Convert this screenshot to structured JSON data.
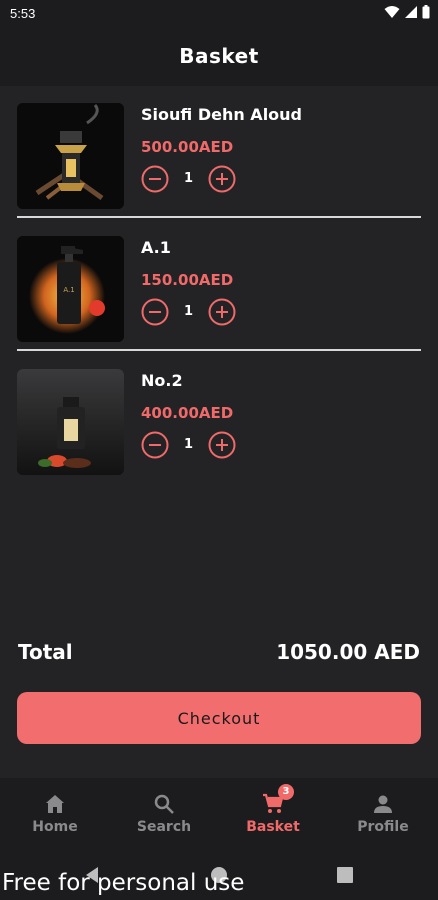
{
  "status": {
    "time": "5:53"
  },
  "header": {
    "title": "Basket"
  },
  "items": [
    {
      "name": "Sioufi Dehn Aloud",
      "price": "500.00AED",
      "qty": "1"
    },
    {
      "name": "A.1",
      "price": "150.00AED",
      "qty": "1"
    },
    {
      "name": "No.2",
      "price": "400.00AED",
      "qty": "1"
    }
  ],
  "summary": {
    "total_label": "Total",
    "total_value": "1050.00 AED"
  },
  "checkout": {
    "label": "Checkout"
  },
  "nav": {
    "items": [
      {
        "label": "Home",
        "icon": "home-icon"
      },
      {
        "label": "Search",
        "icon": "search-icon"
      },
      {
        "label": "Basket",
        "icon": "cart-icon",
        "badge": "3",
        "active": true
      },
      {
        "label": "Profile",
        "icon": "person-icon"
      }
    ]
  },
  "watermark": "Free for personal use",
  "colors": {
    "accent": "#f06a6a",
    "background": "#232326",
    "bar": "#1c1c1e"
  }
}
